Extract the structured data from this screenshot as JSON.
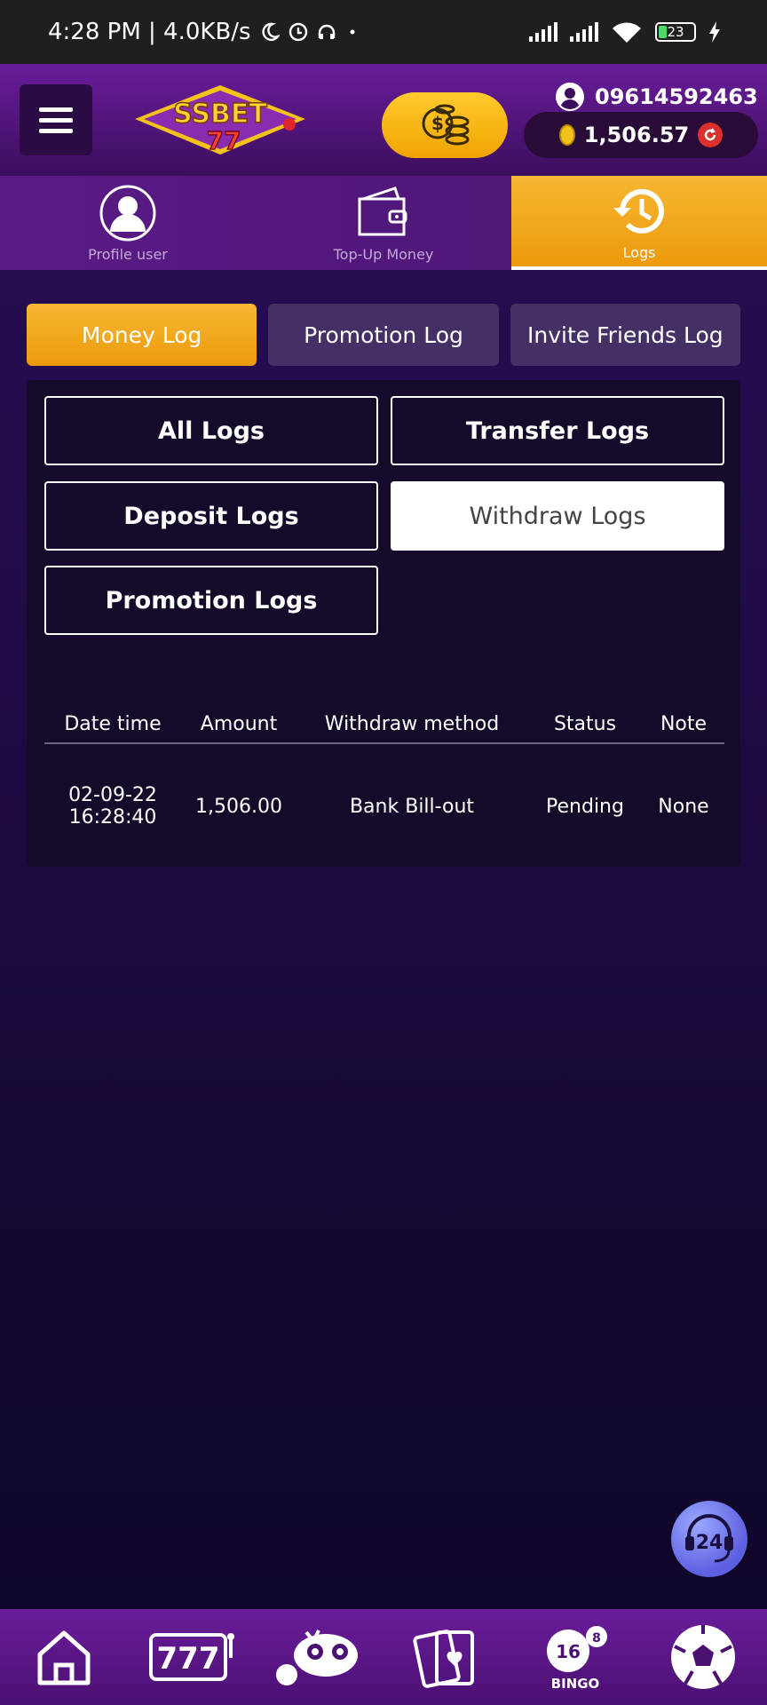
{
  "status_bar": {
    "time_network": "4:28 PM | 4.0KB/s",
    "battery": "23"
  },
  "header": {
    "logo_text_top": "SSBET",
    "logo_text_bottom": "77",
    "phone": "09614592463",
    "balance": "1,506.57"
  },
  "top_tabs": [
    {
      "label": "Profile user",
      "icon": "user-icon"
    },
    {
      "label": "Top-Up Money",
      "icon": "wallet-icon"
    },
    {
      "label": "Logs",
      "icon": "history-icon",
      "active": true
    }
  ],
  "log_tabs": [
    {
      "label": "Money Log",
      "active": true
    },
    {
      "label": "Promotion Log"
    },
    {
      "label": "Invite Friends Log"
    }
  ],
  "filters": {
    "all": "All Logs",
    "transfer": "Transfer Logs",
    "deposit": "Deposit Logs",
    "withdraw": "Withdraw Logs",
    "promotion": "Promotion Logs",
    "selected": "withdraw"
  },
  "table": {
    "headers": [
      "Date time",
      "Amount",
      "Withdraw method",
      "Status",
      "Note"
    ],
    "rows": [
      {
        "date": "02-09-22",
        "time": "16:28:40",
        "amount": "1,506.00",
        "method": "Bank Bill-out",
        "status": "Pending",
        "note": "None"
      }
    ]
  },
  "support": {
    "label": "24"
  },
  "bottom_nav": [
    {
      "icon": "home-icon"
    },
    {
      "icon": "slots-icon",
      "label": "777"
    },
    {
      "icon": "fishing-icon"
    },
    {
      "icon": "cards-icon"
    },
    {
      "icon": "bingo-icon",
      "label": "BINGO",
      "ball": "16",
      "ball2": "8"
    },
    {
      "icon": "soccer-icon"
    }
  ],
  "colors": {
    "accent": "#f0a400",
    "header_purple": "#6a1c9a",
    "background": "#1e0b45"
  }
}
